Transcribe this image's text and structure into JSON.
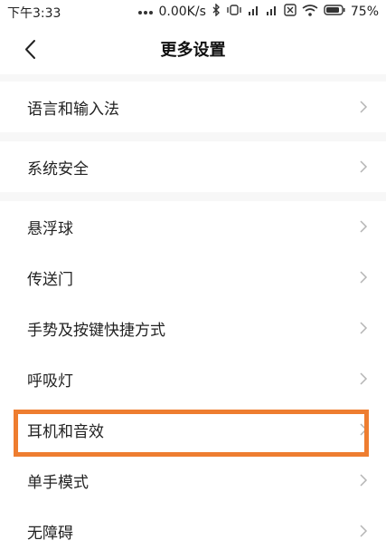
{
  "status_bar": {
    "time": "下午3:33",
    "network_speed": "0.00K/s",
    "battery_percent": "75%",
    "icons": [
      "dots-icon",
      "bluetooth-icon",
      "vibrate-icon",
      "signal-icon",
      "signal-icon",
      "sim-off-icon",
      "wifi-icon",
      "battery-icon"
    ]
  },
  "header": {
    "title": "更多设置",
    "back_icon": "back-arrow-icon"
  },
  "groups": [
    {
      "items": [
        {
          "label": "语言和输入法"
        }
      ]
    },
    {
      "items": [
        {
          "label": "系统安全"
        }
      ]
    },
    {
      "items": [
        {
          "label": "悬浮球"
        },
        {
          "label": "传送门"
        },
        {
          "label": "手势及按键快捷方式"
        },
        {
          "label": "呼吸灯"
        },
        {
          "label": "耳机和音效",
          "highlighted": true
        },
        {
          "label": "单手模式"
        },
        {
          "label": "无障碍"
        }
      ]
    }
  ],
  "colors": {
    "highlight_border": "#ee7d30",
    "background": "#f7f7f7",
    "row_background": "#ffffff"
  }
}
